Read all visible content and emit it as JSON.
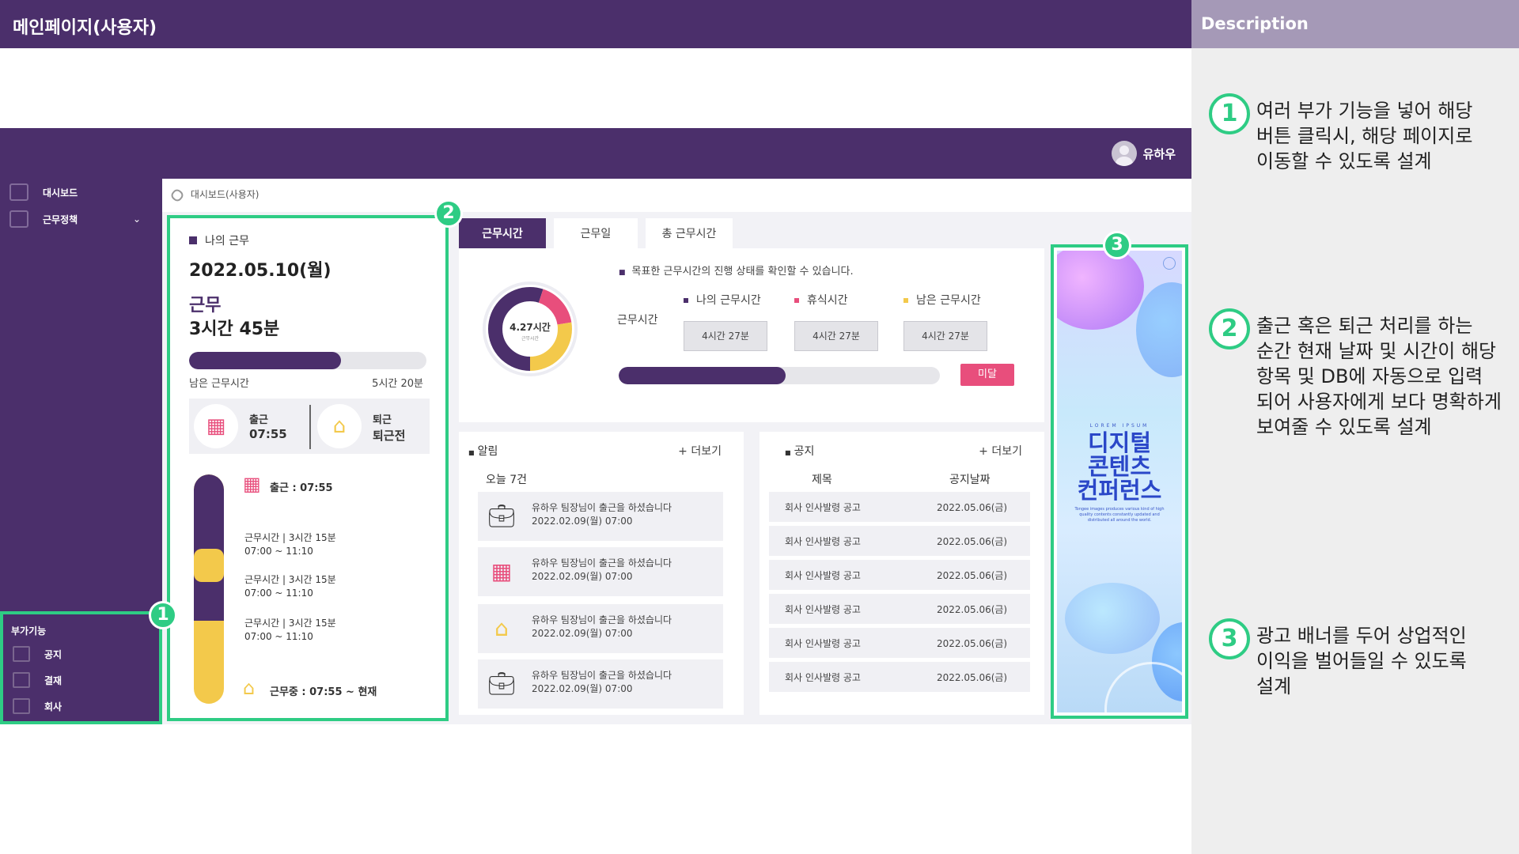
{
  "slide": {
    "title": "메인페이지(사용자)"
  },
  "description": {
    "header": "Description",
    "items": [
      {
        "num": "1",
        "text": "여러 부가 기능을 넣어 해당 버튼 클릭시, 해당 페이지로 이동할 수 있도록 설계"
      },
      {
        "num": "2",
        "text": "출근 혹은 퇴근 처리를 하는 순간 현재 날짜 및 시간이 해당 항목 및 DB에 자동으로 입력 되어 사용자에게 보다 명확하게 보여줄 수 있도록 설계"
      },
      {
        "num": "3",
        "text": "광고 배너를 두어 상업적인 이익을 벌어들일 수 있도록 설계"
      }
    ]
  },
  "app": {
    "user_name": "유하우",
    "sidebar": {
      "items": [
        {
          "label": "대시보드",
          "icon": "clip-icon"
        },
        {
          "label": "근무정책",
          "icon": "chart-icon"
        }
      ],
      "addon": {
        "title": "부가기능",
        "items": [
          {
            "label": "공지",
            "icon": "megaphone-icon"
          },
          {
            "label": "결재",
            "icon": "document-icon"
          },
          {
            "label": "회사",
            "icon": "building-icon"
          }
        ]
      }
    },
    "breadcrumb": "대시보드(사용자)",
    "my_work": {
      "label": "나의 근무",
      "date": "2022.05.10(월)",
      "status": "근무",
      "hours": "3시간 45분",
      "progress": 0.64,
      "remain_label": "남은 근무시간",
      "remain_value": "5시간 20분",
      "in_label": "출근",
      "in_value": "07:55",
      "out_label": "퇴근",
      "out_value": "퇴근전",
      "timeline": {
        "start": "출근 : 07:55",
        "entries": [
          {
            "title": "근무시간 | 3시간 15분",
            "range": "07:00 ~ 11:10"
          },
          {
            "title": "근무시간 | 3시간 15분",
            "range": "07:00 ~ 11:10"
          },
          {
            "title": "근무시간 | 3시간 15분",
            "range": "07:00 ~ 11:10"
          }
        ],
        "current": "근무중 : 07:55 ~ 현재"
      }
    },
    "work_time": {
      "tabs": [
        "근무시간",
        "근무일",
        "총 근무시간"
      ],
      "note": "목표한 근무시간의 진행 상태를 확인할 수 있습니다.",
      "donut_value": "4.27시간",
      "donut_label": "근무시간",
      "row_label": "근무시간",
      "legend": [
        {
          "label": "나의 근무시간",
          "color": "#4b2f6b",
          "value": "4시간 27분"
        },
        {
          "label": "휴식시간",
          "color": "#e84e7c",
          "value": "4시간 27분"
        },
        {
          "label": "남은 근무시간",
          "color": "#f3c94b",
          "value": "4시간 27분"
        }
      ],
      "progress": 0.52,
      "button": "미달"
    },
    "alerts": {
      "title": "알림",
      "more": "+ 더보기",
      "today": "오늘 7건",
      "items": [
        {
          "icon": "briefcase-icon",
          "text": "유하우 팀장님이 출근을 하셨습니다",
          "time": "2022.02.09(월) 07:00"
        },
        {
          "icon": "building-icon",
          "text": "유하우 팀장님이 출근을 하셨습니다",
          "time": "2022.02.09(월) 07:00"
        },
        {
          "icon": "house-icon",
          "text": "유하우 팀장님이 출근을 하셨습니다",
          "time": "2022.02.09(월) 07:00"
        },
        {
          "icon": "briefcase-icon",
          "text": "유하우 팀장님이 출근을 하셨습니다",
          "time": "2022.02.09(월) 07:00"
        }
      ]
    },
    "notices": {
      "title": "공지",
      "more": "+ 더보기",
      "col_title": "제목",
      "col_date": "공지날짜",
      "rows": [
        {
          "title": "회사 인사발령 공고",
          "date": "2022.05.06(금)"
        },
        {
          "title": "회사 인사발령 공고",
          "date": "2022.05.06(금)"
        },
        {
          "title": "회사 인사발령 공고",
          "date": "2022.05.06(금)"
        },
        {
          "title": "회사 인사발령 공고",
          "date": "2022.05.06(금)"
        },
        {
          "title": "회사 인사발령 공고",
          "date": "2022.05.06(금)"
        },
        {
          "title": "회사 인사발령 공고",
          "date": "2022.05.06(금)"
        }
      ]
    },
    "ad": {
      "small": "LOREM IPSUM",
      "title": "디지털\n콘텐츠\n컨퍼런스",
      "desc": "Tongee images produces various kind of high quality contents constantly updated and distributed all around the world."
    }
  },
  "colors": {
    "brand": "#4b2f6b",
    "accent_green": "#2ecc84",
    "accent_pink": "#e84e7c",
    "accent_yellow": "#f3c94b"
  }
}
